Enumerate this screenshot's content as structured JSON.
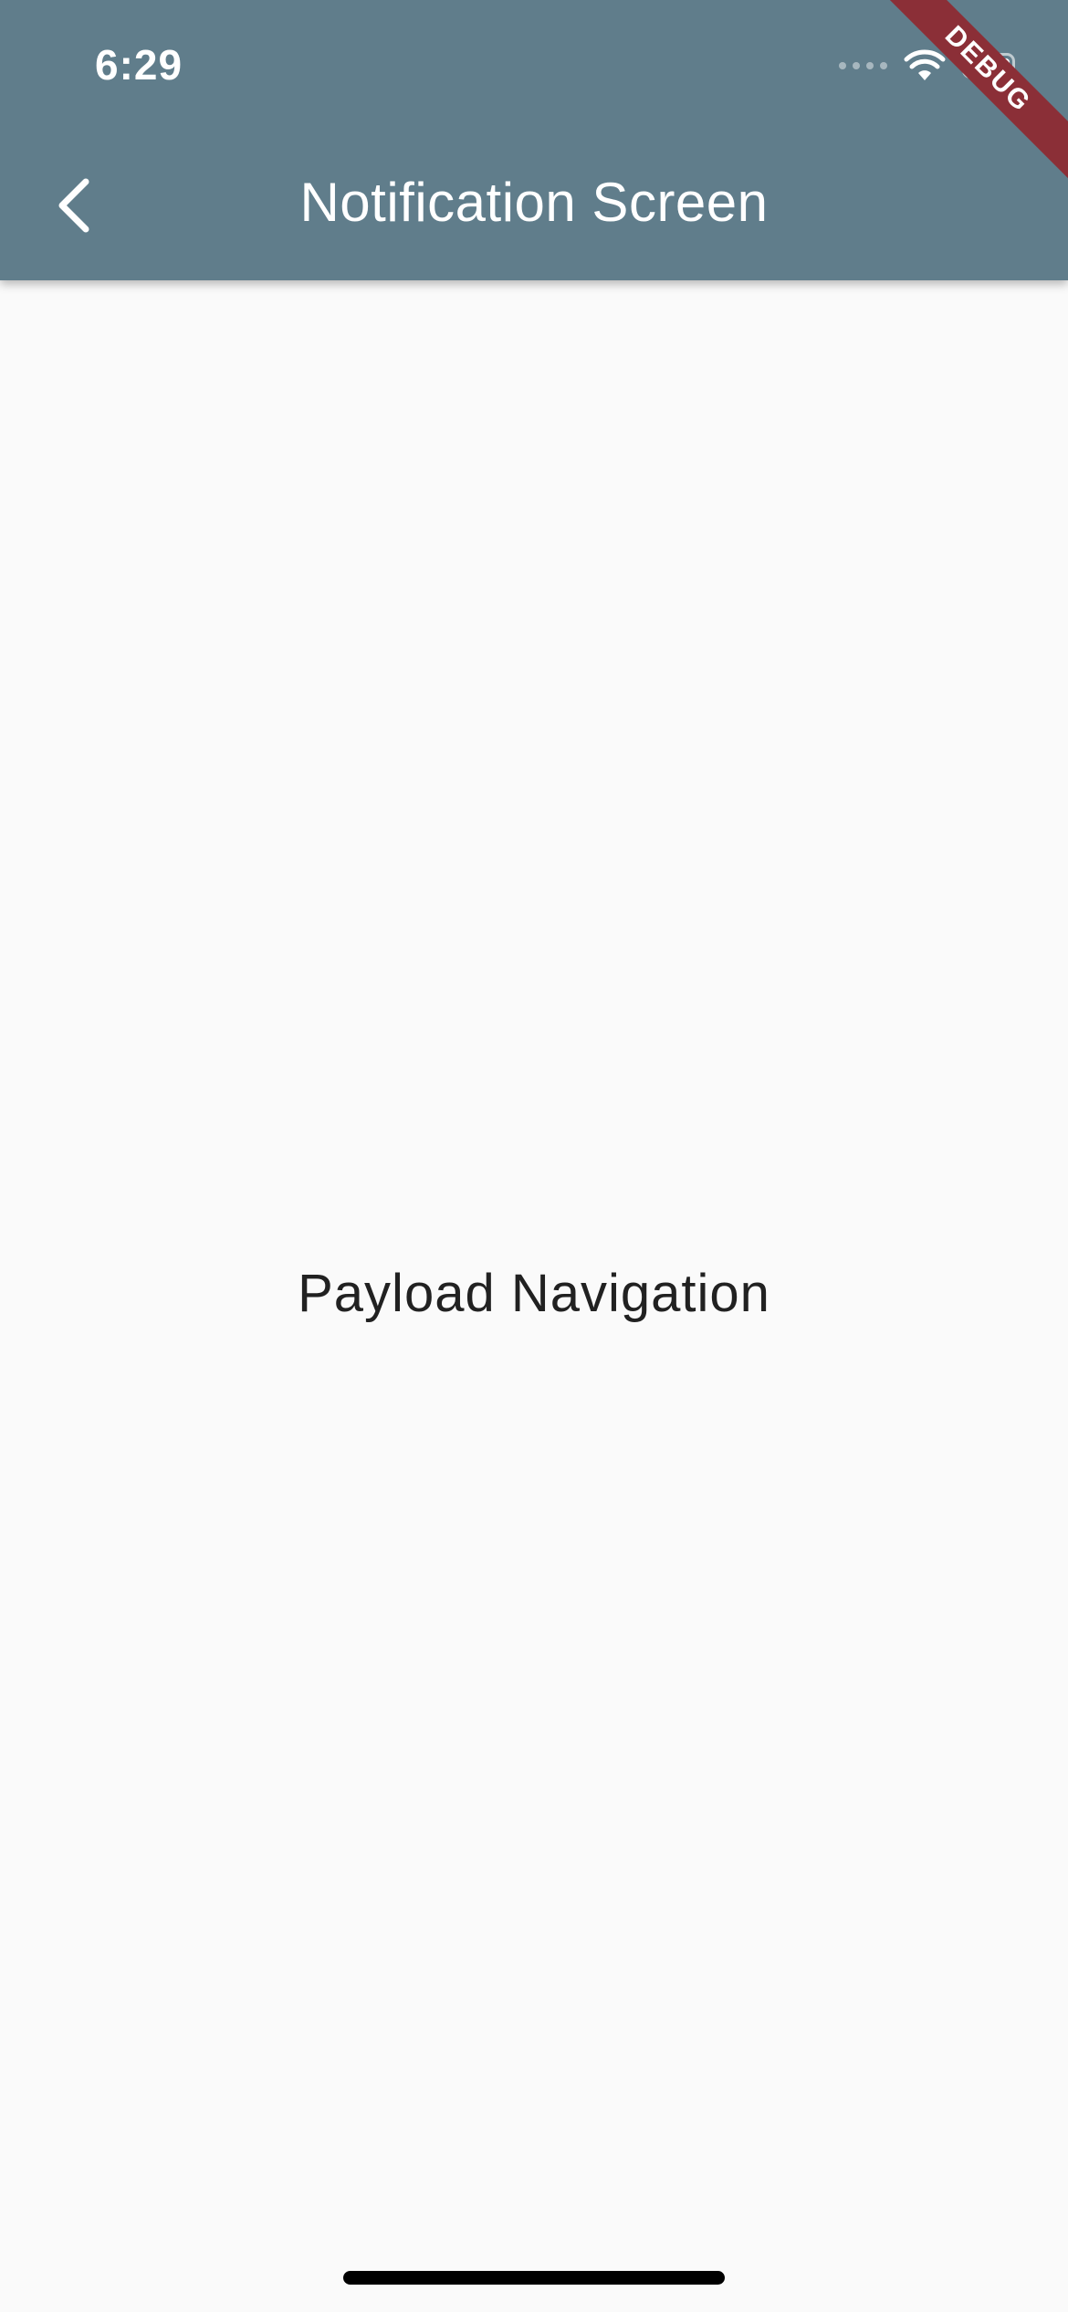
{
  "status_bar": {
    "time": "6:29"
  },
  "app_bar": {
    "title": "Notification Screen",
    "back_icon": "chevron-left-icon",
    "background_color": "#607d8b"
  },
  "debug_banner": {
    "label": "DEBUG",
    "color": "#8b2f37"
  },
  "main": {
    "message": "Payload Navigation"
  },
  "icons": {
    "wifi": "wifi-icon",
    "battery": "battery-icon",
    "signal": "signal-icon"
  }
}
